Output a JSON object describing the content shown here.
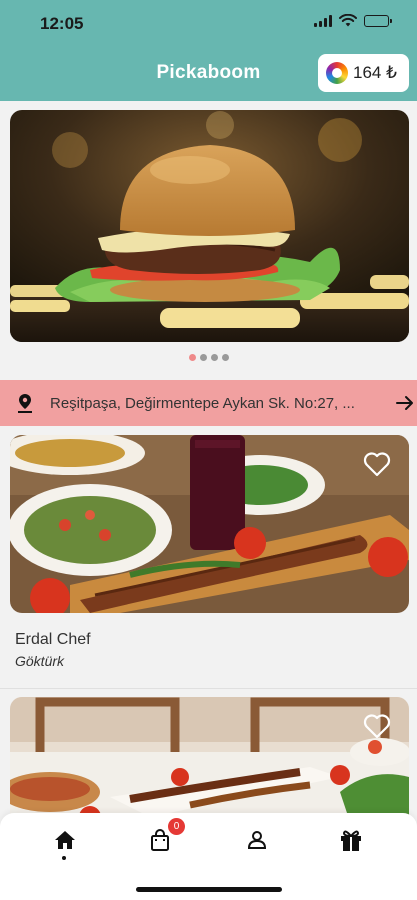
{
  "status_bar": {
    "time": "12:05"
  },
  "header": {
    "title": "Pickaboom",
    "balance": "164 ₺",
    "accent_color": "#67b7b0"
  },
  "banner": {
    "image": "burger-photo",
    "pager_count": 4,
    "pager_active_index": 0
  },
  "address": {
    "text": "Reşitpaşa, Değirmentepe Aykan Sk. No:27, ...",
    "background_color": "#f1a0a0"
  },
  "restaurants": [
    {
      "name": "Erdal Chef",
      "location": "Göktürk",
      "image": "kebab-plate-photo",
      "favorite": false
    },
    {
      "image": "mixed-grill-table-photo",
      "favorite": false
    }
  ],
  "tab_bar": {
    "tabs": [
      {
        "id": "home",
        "icon": "home-icon",
        "active": true
      },
      {
        "id": "cart",
        "icon": "shopping-bag-icon",
        "badge": "0"
      },
      {
        "id": "profile",
        "icon": "user-icon"
      },
      {
        "id": "gifts",
        "icon": "gift-icon"
      }
    ]
  }
}
